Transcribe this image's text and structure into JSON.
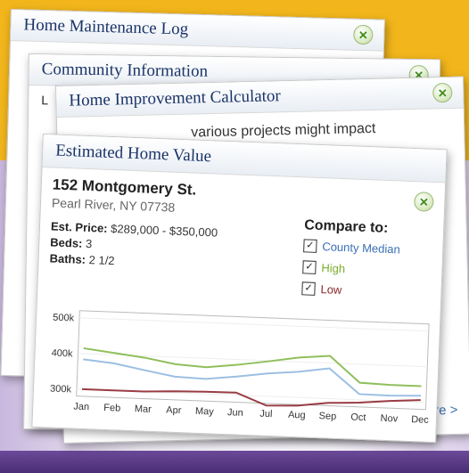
{
  "cards": {
    "maintenance": {
      "title": "Home Maintenance Log"
    },
    "community": {
      "title": "Community Information",
      "body_partial": "L"
    },
    "calculator": {
      "title": "Home Improvement Calculator",
      "body_partial": "various projects might impact",
      "more_link": "re >"
    },
    "value": {
      "title": "Estimated Home Value",
      "address": "152 Montgomery St.",
      "city": "Pearl River, NY 07738",
      "est_price_label": "Est. Price:",
      "est_price": "$289,000 - $350,000",
      "beds_label": "Beds:",
      "beds": "3",
      "baths_label": "Baths:",
      "baths": "2 1/2",
      "compare_title": "Compare to:",
      "compare": [
        {
          "label": "County Median",
          "color": "#3b6fb6",
          "checked": "✓"
        },
        {
          "label": "High",
          "color": "#7cad2e",
          "checked": "✓"
        },
        {
          "label": "Low",
          "color": "#8b2a2a",
          "checked": "✓"
        }
      ]
    }
  },
  "colors": {
    "close_green": "#3f8d1e",
    "title_navy": "#1a3468",
    "background_gold": "#f2b61c"
  },
  "close_glyph": "✕",
  "chart_data": {
    "type": "line",
    "categories": [
      "Jan",
      "Feb",
      "Mar",
      "Apr",
      "May",
      "Jun",
      "Jul",
      "Aug",
      "Sep",
      "Oct",
      "Nov",
      "Dec"
    ],
    "y_ticks": [
      "500k",
      "400k",
      "300k"
    ],
    "ylim": [
      280,
      520
    ],
    "series": [
      {
        "name": "High",
        "color": "#8fbf5b",
        "values": [
          415,
          405,
          395,
          380,
          375,
          385,
          398,
          412,
          420,
          348,
          345,
          345
        ]
      },
      {
        "name": "County Median",
        "color": "#9cbfe3",
        "values": [
          384,
          376,
          360,
          345,
          342,
          352,
          364,
          372,
          385,
          316,
          315,
          318
        ]
      },
      {
        "name": "Low",
        "color": "#9a3b44",
        "values": [
          300,
          300,
          300,
          304,
          306,
          307,
          274,
          277,
          288,
          292,
          300,
          306
        ]
      }
    ]
  }
}
